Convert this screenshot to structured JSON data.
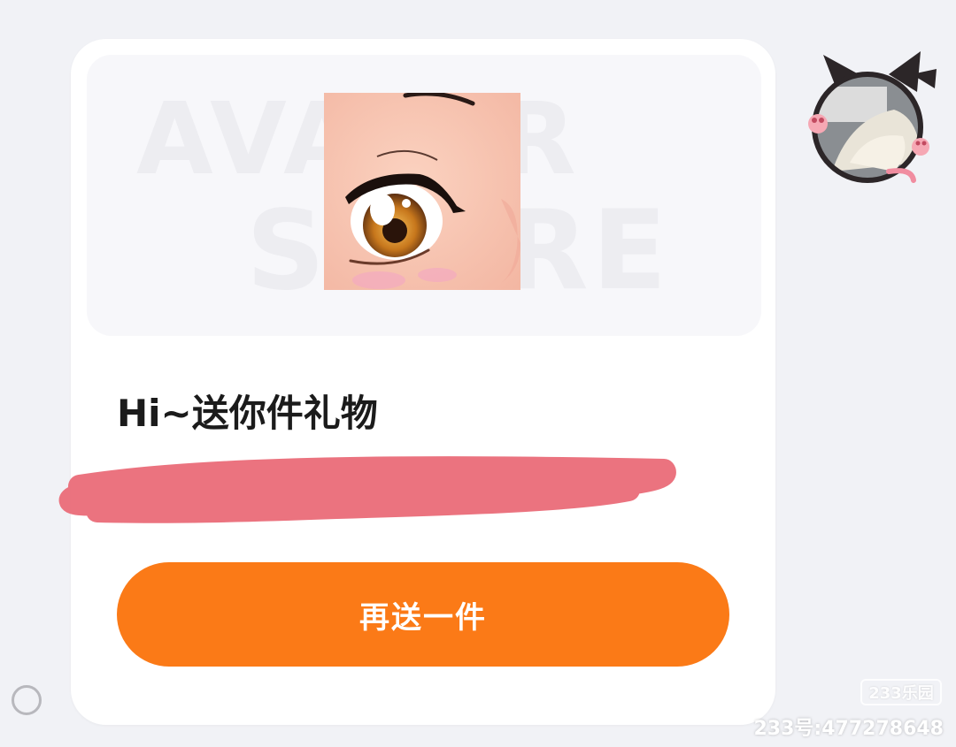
{
  "banner": {
    "watermark_line1": "AVATAR",
    "watermark_line2": "STORE",
    "image_icon": "anime-eye-illustration"
  },
  "card": {
    "title": "Hi~送你件礼物",
    "redacted_icon": "redaction-scribble",
    "redaction_color": "#ea6b78",
    "button_label": "再送一件",
    "button_color": "#fb7a17"
  },
  "avatar": {
    "icon": "cat-ear-avatar"
  },
  "selection": {
    "icon": "radio-circle-icon"
  },
  "watermark": {
    "logo": "233乐园",
    "text": "233号:477278648"
  }
}
